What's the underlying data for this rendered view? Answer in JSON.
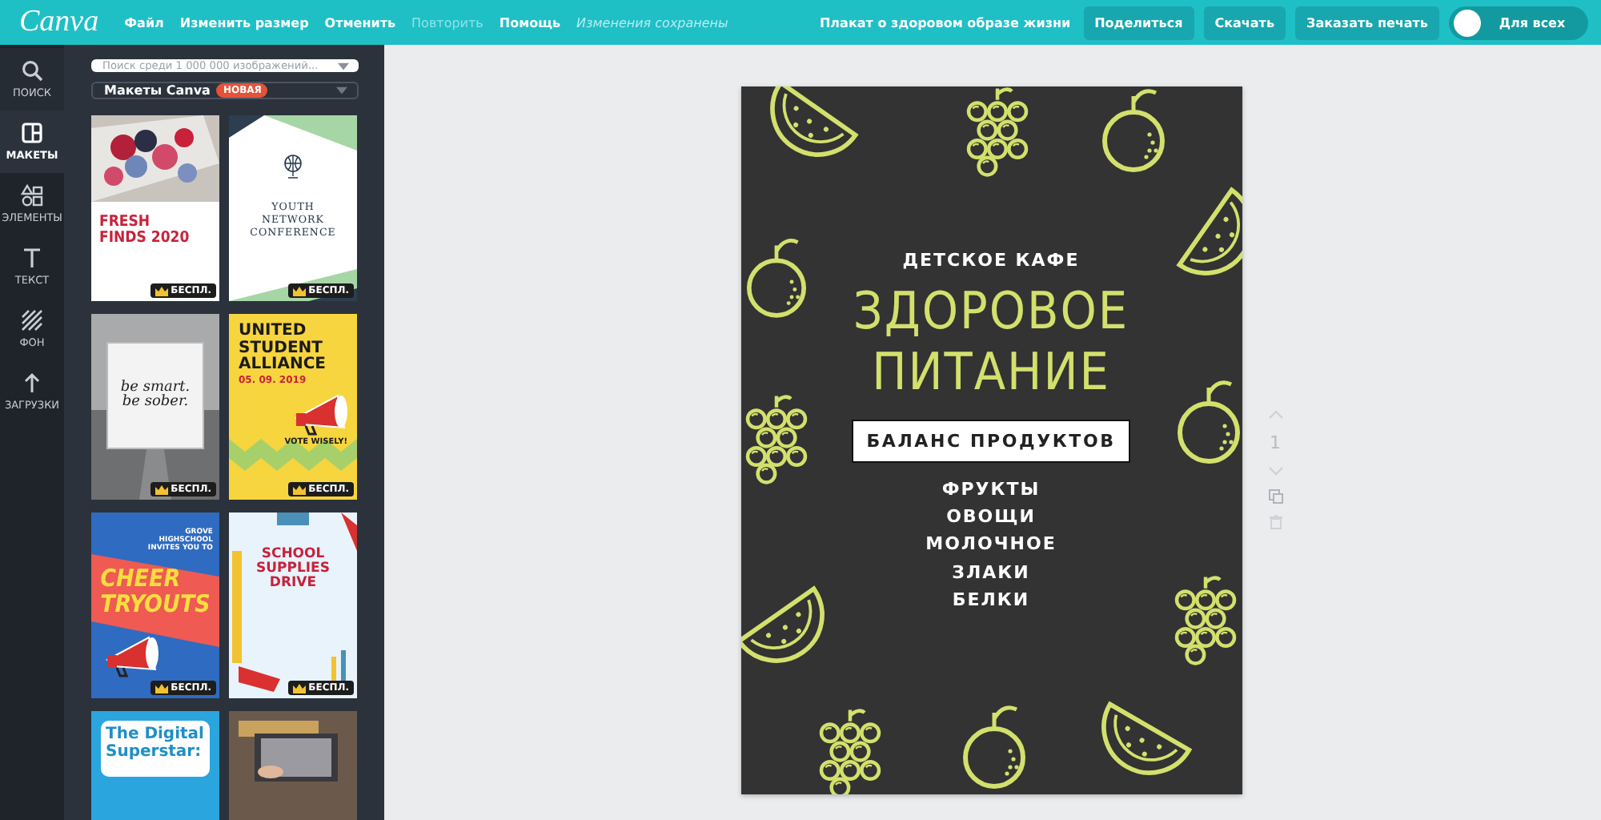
{
  "topbar": {
    "logo": "Canva",
    "menu": [
      {
        "label": "Файл",
        "disabled": false
      },
      {
        "label": "Изменить размер",
        "disabled": false
      },
      {
        "label": "Отменить",
        "disabled": false
      },
      {
        "label": "Повторить",
        "disabled": true
      },
      {
        "label": "Помощь",
        "disabled": false
      }
    ],
    "save_status": "Изменения сохранены",
    "document_title": "Плакат о здоровом образе жизни",
    "buttons": [
      "Поделиться",
      "Скачать",
      "Заказать печать"
    ],
    "visibility": {
      "label": "Для всех"
    }
  },
  "rail": [
    {
      "kind": "search",
      "label": "ПОИСК",
      "selected": false
    },
    {
      "kind": "layouts",
      "label": "МАКЕТЫ",
      "selected": true
    },
    {
      "kind": "elements",
      "label": "ЭЛЕМЕНТЫ",
      "selected": false
    },
    {
      "kind": "text",
      "label": "ТЕКСТ",
      "selected": false
    },
    {
      "kind": "background",
      "label": "ФОН",
      "selected": false
    },
    {
      "kind": "uploads",
      "label": "ЗАГРУЗКИ",
      "selected": false
    }
  ],
  "panel": {
    "search": {
      "placeholder": "Поиск среди 1 000 000 изображений..."
    },
    "source": {
      "label": "Макеты Canva",
      "badge": "НОВАЯ"
    }
  },
  "templates": [
    {
      "kind": "berries",
      "lines": [
        "FRESH",
        "FINDS 2020"
      ],
      "badge": "БЕСПЛ."
    },
    {
      "kind": "conference",
      "lines": [
        "YOUTH",
        "NETWORK",
        "CONFERENCE"
      ],
      "badge": "БЕСПЛ."
    },
    {
      "kind": "road",
      "lines": [
        "be smart.",
        "be sober."
      ],
      "badge": "БЕСПЛ."
    },
    {
      "kind": "rally",
      "lines": [
        "UNITED",
        "STUDENT",
        "ALLIANCE"
      ],
      "date": "05. 09. 2019",
      "tagline": "VOTE WISELY!",
      "badge": "БЕСПЛ."
    },
    {
      "kind": "cheer",
      "intro": "GROVE HIGHSCHOOL INVITES YOU TO",
      "lines": [
        "CHEER",
        "TRYOUTS"
      ],
      "badge": "БЕСПЛ."
    },
    {
      "kind": "supplies",
      "lines": [
        "SCHOOL",
        "SUPPLIES",
        "DRIVE"
      ],
      "badge": "БЕСПЛ."
    },
    {
      "kind": "digital",
      "lines": [
        "The Digital",
        "Superstar:"
      ]
    },
    {
      "kind": "laptop"
    }
  ],
  "poster": {
    "subtitle": "ДЕТСКОЕ КАФЕ",
    "title_lines": [
      "ЗДОРОВОЕ",
      "ПИТАНИЕ"
    ],
    "boxed": "БАЛАНС ПРОДУКТОВ",
    "items": [
      "ФРУКТЫ",
      "ОВОЩИ",
      "МОЛОЧНОЕ",
      "ЗЛАКИ",
      "БЕЛКИ"
    ]
  },
  "page_controls": {
    "page_number": "1"
  }
}
